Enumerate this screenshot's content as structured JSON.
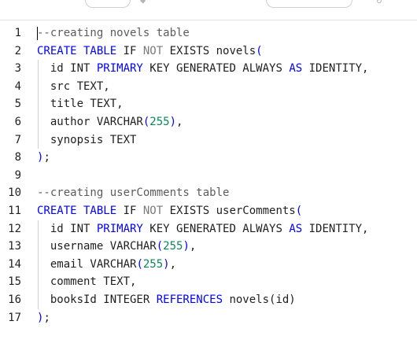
{
  "toolbar": {
    "note": ""
  },
  "editor": {
    "lines": [
      {
        "n": "1",
        "tokens": [
          [
            "cm",
            "--creating novels table"
          ]
        ]
      },
      {
        "n": "2",
        "tokens": [
          [
            "kw",
            "CREATE TABLE "
          ],
          [
            "tx",
            "IF "
          ],
          [
            "lit",
            "NOT "
          ],
          [
            "tx",
            "EXISTS novels"
          ],
          [
            "kw",
            "("
          ]
        ]
      },
      {
        "n": "3",
        "tokens": [
          [
            "tx",
            "  id INT "
          ],
          [
            "kw",
            "PRIMARY "
          ],
          [
            "tx",
            "KEY GENERATED ALWAYS "
          ],
          [
            "kw",
            "AS "
          ],
          [
            "tx",
            "IDENTITY,"
          ]
        ]
      },
      {
        "n": "4",
        "tokens": [
          [
            "tx",
            "  src TEXT,"
          ]
        ]
      },
      {
        "n": "5",
        "tokens": [
          [
            "tx",
            "  title TEXT,"
          ]
        ]
      },
      {
        "n": "6",
        "tokens": [
          [
            "tx",
            "  author VARCHAR"
          ],
          [
            "kw",
            "("
          ],
          [
            "num",
            "255"
          ],
          [
            "kw",
            ")"
          ],
          [
            "tx",
            ","
          ]
        ]
      },
      {
        "n": "7",
        "tokens": [
          [
            "tx",
            "  synopsis TEXT"
          ]
        ]
      },
      {
        "n": "8",
        "tokens": [
          [
            "kw",
            ")"
          ],
          [
            "tx",
            ";"
          ]
        ]
      },
      {
        "n": "9",
        "tokens": []
      },
      {
        "n": "10",
        "tokens": [
          [
            "cm",
            "--creating userComments table"
          ]
        ]
      },
      {
        "n": "11",
        "tokens": [
          [
            "kw",
            "CREATE TABLE "
          ],
          [
            "tx",
            "IF "
          ],
          [
            "lit",
            "NOT "
          ],
          [
            "tx",
            "EXISTS userComments"
          ],
          [
            "kw",
            "("
          ]
        ]
      },
      {
        "n": "12",
        "tokens": [
          [
            "tx",
            "  id INT "
          ],
          [
            "kw",
            "PRIMARY "
          ],
          [
            "tx",
            "KEY GENERATED ALWAYS "
          ],
          [
            "kw",
            "AS "
          ],
          [
            "tx",
            "IDENTITY,"
          ]
        ]
      },
      {
        "n": "13",
        "tokens": [
          [
            "tx",
            "  username VARCHAR"
          ],
          [
            "kw",
            "("
          ],
          [
            "num",
            "255"
          ],
          [
            "kw",
            ")"
          ],
          [
            "tx",
            ","
          ]
        ]
      },
      {
        "n": "14",
        "tokens": [
          [
            "tx",
            "  email VARCHAR"
          ],
          [
            "kw",
            "("
          ],
          [
            "num",
            "255"
          ],
          [
            "kw",
            ")"
          ],
          [
            "tx",
            ","
          ]
        ]
      },
      {
        "n": "15",
        "tokens": [
          [
            "tx",
            "  comment TEXT,"
          ]
        ]
      },
      {
        "n": "16",
        "tokens": [
          [
            "tx",
            "  booksId INTEGER "
          ],
          [
            "kw",
            "REFERENCES "
          ],
          [
            "tx",
            "novels(id)"
          ]
        ]
      },
      {
        "n": "17",
        "tokens": [
          [
            "kw",
            ")"
          ],
          [
            "tx",
            ";"
          ]
        ]
      }
    ],
    "guided_lines": [
      "3",
      "4",
      "5",
      "6",
      "7",
      "12",
      "13",
      "14",
      "15",
      "16"
    ]
  },
  "colors": {
    "keyword": "#0000ff",
    "comment": "#5c5c5c",
    "number": "#098658",
    "text": "#1f1f1f"
  }
}
